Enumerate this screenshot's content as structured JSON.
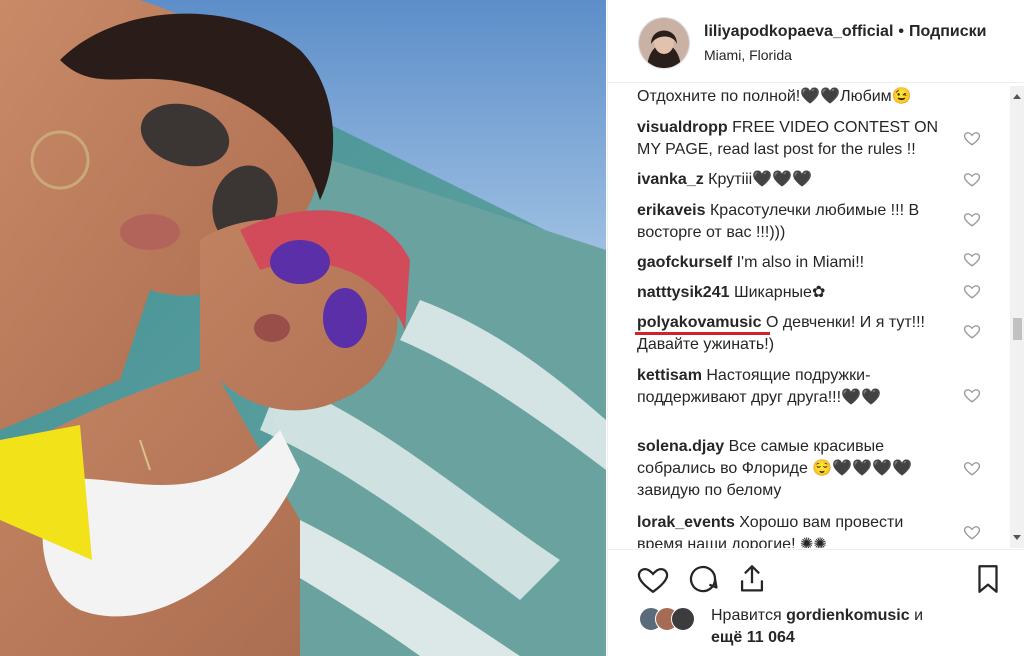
{
  "post": {
    "username": "liliyapodkopaeva_official",
    "separator": "•",
    "follow_label": "Подписки",
    "location": "Miami, Florida"
  },
  "comments": [
    {
      "user": "",
      "text": "Отдохните по полной!🖤🖤Любим😉"
    },
    {
      "user": "visualdropp",
      "text": "FREE VIDEO CONTEST ON MY PAGE, read last post for the rules !!"
    },
    {
      "user": "ivanka_z",
      "text": "Крутііі🖤🖤🖤"
    },
    {
      "user": "erikaveis",
      "text": "Красотулечки любимые !!! В восторге от вас !!!)))"
    },
    {
      "user": "gaofckurself",
      "text": "I'm also in Miami!!"
    },
    {
      "user": "natttysik241",
      "text": "Шикарные✿"
    },
    {
      "user": "polyakovamusic",
      "text": "О девченки! И я тут!!! Давайте ужинать!)"
    },
    {
      "user": "kettisam",
      "text": "Настоящие подружки-поддерживают друг друга!!!🖤🖤"
    },
    {
      "user": "solena.djay",
      "text": "Все самые красивые собрались во Флориде 😌🖤🖤🖤🖤 завидую по белому"
    },
    {
      "user": "lorak_events",
      "text": "Хорошо вам провести время наши дорогие! ✺✺"
    }
  ],
  "likes": {
    "prefix": "Нравится",
    "user": "gordienkomusic",
    "conj": "и",
    "count_text": "ещё 11 064"
  },
  "icons": {
    "like": "heart-outline-icon",
    "comment": "comment-bubble-icon",
    "share": "share-upload-icon",
    "save": "bookmark-icon"
  },
  "colors": {
    "accent_underline": "#d4202a",
    "text": "#262626"
  }
}
